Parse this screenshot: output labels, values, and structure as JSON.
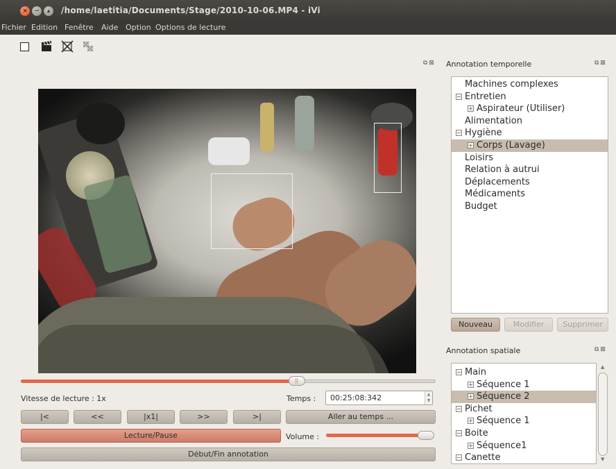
{
  "window": {
    "title": "/home/laetitia/Documents/Stage/2010-10-06.MP4 - iVi"
  },
  "menu": [
    "Fichier",
    "Edition",
    "Fenêtre",
    "Aide",
    "Option",
    "Options de lecture"
  ],
  "toolbar": {
    "tools": [
      "rectangle-tool",
      "clapperboard-tool",
      "delete-box-tool",
      "delete-all-tool"
    ]
  },
  "player": {
    "speed_label": "Vitesse de lecture : 1x",
    "time_label": "Temps :",
    "time_value": "00:25:08:342",
    "seek_progress": 0.665,
    "buttons": [
      "|<",
      "<<",
      "|x1|",
      ">>",
      ">|"
    ],
    "goto_label": "Aller au temps ...",
    "play_pause_label": "Lecture/Pause",
    "volume_label": "Volume :",
    "volume_level": 0.96,
    "annotation_label": "Début/Fin annotation"
  },
  "temporal_panel": {
    "title": "Annotation temporelle",
    "items": [
      {
        "label": "Machines complexes",
        "level": 0,
        "expander": "",
        "selected": false
      },
      {
        "label": "Entretien",
        "level": 0,
        "expander": "−",
        "selected": false
      },
      {
        "label": "Aspirateur (Utiliser)",
        "level": 1,
        "expander": "+",
        "selected": false
      },
      {
        "label": "Alimentation",
        "level": 0,
        "expander": "",
        "selected": false
      },
      {
        "label": "Hygiène",
        "level": 0,
        "expander": "−",
        "selected": false
      },
      {
        "label": "Corps (Lavage)",
        "level": 1,
        "expander": "+",
        "selected": true
      },
      {
        "label": "Loisirs",
        "level": 0,
        "expander": "",
        "selected": false
      },
      {
        "label": "Relation à autrui",
        "level": 0,
        "expander": "",
        "selected": false
      },
      {
        "label": "Déplacements",
        "level": 0,
        "expander": "",
        "selected": false
      },
      {
        "label": "Médicaments",
        "level": 0,
        "expander": "",
        "selected": false
      },
      {
        "label": "Budget",
        "level": 0,
        "expander": "",
        "selected": false
      }
    ],
    "buttons": {
      "new": "Nouveau",
      "edit": "Modifier",
      "delete": "Supprimer"
    }
  },
  "spatial_panel": {
    "title": "Annotation spatiale",
    "items": [
      {
        "label": "Main",
        "level": 0,
        "expander": "−",
        "selected": false
      },
      {
        "label": "Séquence 1",
        "level": 1,
        "expander": "+",
        "selected": false
      },
      {
        "label": "Séquence 2",
        "level": 1,
        "expander": "+",
        "selected": true
      },
      {
        "label": "Pichet",
        "level": 0,
        "expander": "−",
        "selected": false
      },
      {
        "label": "Séquence 1",
        "level": 1,
        "expander": "+",
        "selected": false
      },
      {
        "label": "Boite",
        "level": 0,
        "expander": "−",
        "selected": false
      },
      {
        "label": "Séquence1",
        "level": 1,
        "expander": "+",
        "selected": false
      },
      {
        "label": "Canette",
        "level": 0,
        "expander": "−",
        "selected": false
      }
    ]
  },
  "colors": {
    "accent": "#e0674a",
    "selected_row": "#c8bcae",
    "titlebar": "#3a3935"
  }
}
